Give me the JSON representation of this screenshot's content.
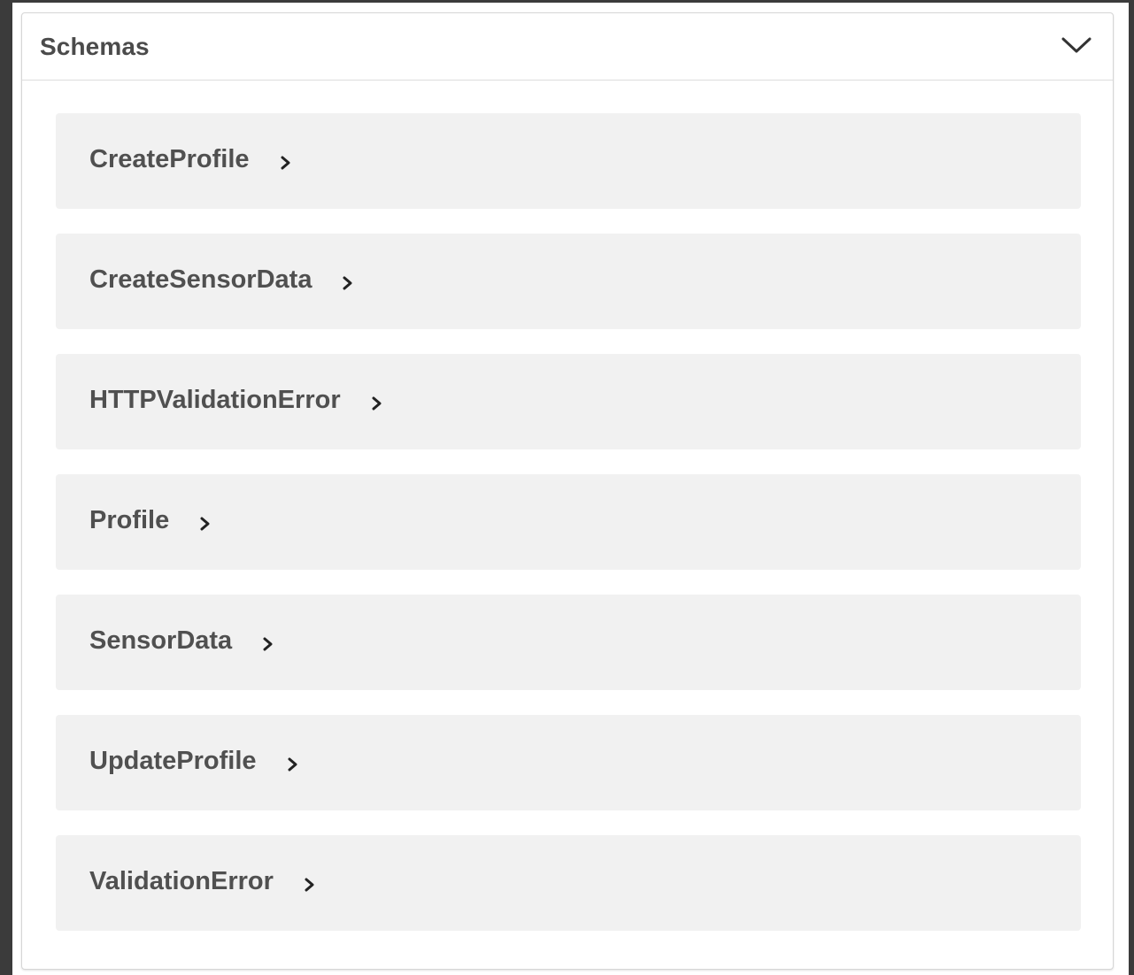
{
  "schemas": {
    "title": "Schemas",
    "toggle_icon": "chevron-down-icon",
    "models": [
      {
        "name": "CreateProfile",
        "icon": "chevron-right-icon"
      },
      {
        "name": "CreateSensorData",
        "icon": "chevron-right-icon"
      },
      {
        "name": "HTTPValidationError",
        "icon": "chevron-right-icon"
      },
      {
        "name": "Profile",
        "icon": "chevron-right-icon"
      },
      {
        "name": "SensorData",
        "icon": "chevron-right-icon"
      },
      {
        "name": "UpdateProfile",
        "icon": "chevron-right-icon"
      },
      {
        "name": "ValidationError",
        "icon": "chevron-right-icon"
      }
    ]
  },
  "colors": {
    "outer_background": "#3b3b3b",
    "panel_background": "#ffffff",
    "model_background": "#f1f1f1",
    "text": "#4b4b4b"
  }
}
